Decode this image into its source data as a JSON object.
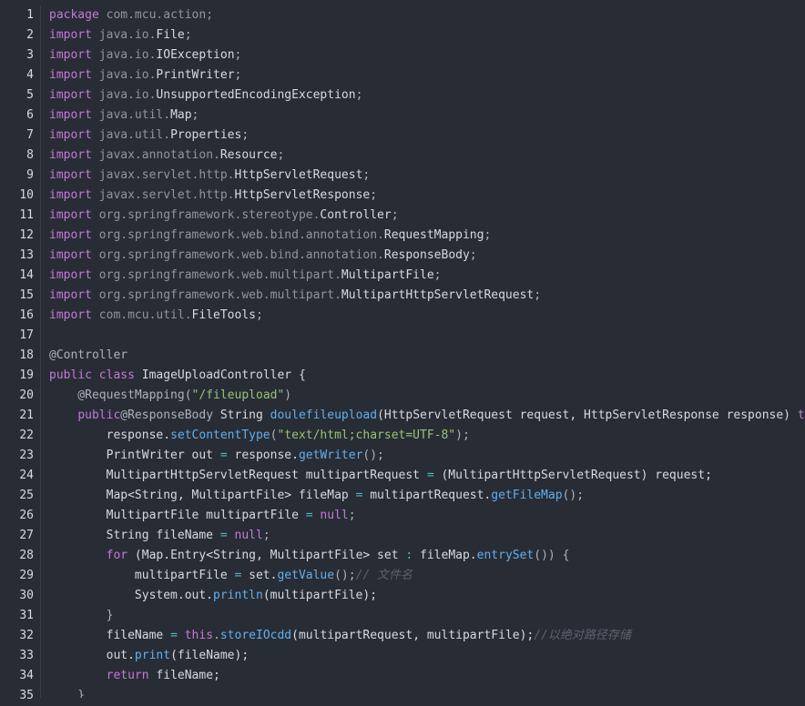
{
  "editor": {
    "line_numbers": [
      "1",
      "2",
      "3",
      "4",
      "5",
      "6",
      "7",
      "8",
      "9",
      "10",
      "11",
      "12",
      "13",
      "14",
      "15",
      "16",
      "17",
      "18",
      "19",
      "20",
      "21",
      "22",
      "23",
      "24",
      "25",
      "26",
      "27",
      "28",
      "29",
      "30",
      "31",
      "32",
      "33",
      "34",
      "35"
    ],
    "lines": [
      [
        {
          "t": "package",
          "c": "kw"
        },
        {
          "t": " com.mcu.action;",
          "c": "pkg"
        }
      ],
      [
        {
          "t": "import",
          "c": "kw"
        },
        {
          "t": " java.io.",
          "c": "pkg"
        },
        {
          "t": "File",
          "c": "ty"
        },
        {
          "t": ";",
          "c": "pl"
        }
      ],
      [
        {
          "t": "import",
          "c": "kw"
        },
        {
          "t": " java.io.",
          "c": "pkg"
        },
        {
          "t": "IOException",
          "c": "ty"
        },
        {
          "t": ";",
          "c": "pl"
        }
      ],
      [
        {
          "t": "import",
          "c": "kw"
        },
        {
          "t": " java.io.",
          "c": "pkg"
        },
        {
          "t": "PrintWriter",
          "c": "ty"
        },
        {
          "t": ";",
          "c": "pl"
        }
      ],
      [
        {
          "t": "import",
          "c": "kw"
        },
        {
          "t": " java.io.",
          "c": "pkg"
        },
        {
          "t": "UnsupportedEncodingException",
          "c": "ty"
        },
        {
          "t": ";",
          "c": "pl"
        }
      ],
      [
        {
          "t": "import",
          "c": "kw"
        },
        {
          "t": " java.util.",
          "c": "pkg"
        },
        {
          "t": "Map",
          "c": "ty"
        },
        {
          "t": ";",
          "c": "pl"
        }
      ],
      [
        {
          "t": "import",
          "c": "kw"
        },
        {
          "t": " java.util.",
          "c": "pkg"
        },
        {
          "t": "Properties",
          "c": "ty"
        },
        {
          "t": ";",
          "c": "pl"
        }
      ],
      [
        {
          "t": "import",
          "c": "kw"
        },
        {
          "t": " javax.annotation.",
          "c": "pkg"
        },
        {
          "t": "Resource",
          "c": "ty"
        },
        {
          "t": ";",
          "c": "pl"
        }
      ],
      [
        {
          "t": "import",
          "c": "kw"
        },
        {
          "t": " javax.servlet.http.",
          "c": "pkg"
        },
        {
          "t": "HttpServletRequest",
          "c": "ty"
        },
        {
          "t": ";",
          "c": "pl"
        }
      ],
      [
        {
          "t": "import",
          "c": "kw"
        },
        {
          "t": " javax.servlet.http.",
          "c": "pkg"
        },
        {
          "t": "HttpServletResponse",
          "c": "ty"
        },
        {
          "t": ";",
          "c": "pl"
        }
      ],
      [
        {
          "t": "import",
          "c": "kw"
        },
        {
          "t": " org.springframework.stereotype.",
          "c": "pkg"
        },
        {
          "t": "Controller",
          "c": "ty"
        },
        {
          "t": ";",
          "c": "pl"
        }
      ],
      [
        {
          "t": "import",
          "c": "kw"
        },
        {
          "t": " org.springframework.web.bind.annotation.",
          "c": "pkg"
        },
        {
          "t": "RequestMapping",
          "c": "ty"
        },
        {
          "t": ";",
          "c": "pl"
        }
      ],
      [
        {
          "t": "import",
          "c": "kw"
        },
        {
          "t": " org.springframework.web.bind.annotation.",
          "c": "pkg"
        },
        {
          "t": "ResponseBody",
          "c": "ty"
        },
        {
          "t": ";",
          "c": "pl"
        }
      ],
      [
        {
          "t": "import",
          "c": "kw"
        },
        {
          "t": " org.springframework.web.multipart.",
          "c": "pkg"
        },
        {
          "t": "MultipartFile",
          "c": "ty"
        },
        {
          "t": ";",
          "c": "pl"
        }
      ],
      [
        {
          "t": "import",
          "c": "kw"
        },
        {
          "t": " org.springframework.web.multipart.",
          "c": "pkg"
        },
        {
          "t": "MultipartHttpServletRequest",
          "c": "ty"
        },
        {
          "t": ";",
          "c": "pl"
        }
      ],
      [
        {
          "t": "import",
          "c": "kw"
        },
        {
          "t": " com.mcu.util.",
          "c": "pkg"
        },
        {
          "t": "FileTools",
          "c": "ty"
        },
        {
          "t": ";",
          "c": "pl"
        }
      ],
      [],
      [
        {
          "t": "@Controller",
          "c": "ann"
        }
      ],
      [
        {
          "t": "public",
          "c": "kw"
        },
        {
          "t": " ",
          "c": "pl"
        },
        {
          "t": "class",
          "c": "kw"
        },
        {
          "t": " ImageUploadController {",
          "c": "ty"
        }
      ],
      [
        {
          "t": "    @RequestMapping(",
          "c": "ann"
        },
        {
          "t": "\"/fileupload\"",
          "c": "str"
        },
        {
          "t": ")",
          "c": "ann"
        }
      ],
      [
        {
          "t": "    ",
          "c": "pl"
        },
        {
          "t": "public",
          "c": "kw"
        },
        {
          "t": "@ResponseBody",
          "c": "ann"
        },
        {
          "t": " String ",
          "c": "ty"
        },
        {
          "t": "doulefileupload",
          "c": "fn"
        },
        {
          "t": "(HttpServletRequest request, HttpServletResponse response) ",
          "c": "ty"
        },
        {
          "t": "throws",
          "c": "kw"
        }
      ],
      [
        {
          "t": "        response.",
          "c": "ty"
        },
        {
          "t": "setContentType",
          "c": "fn"
        },
        {
          "t": "(",
          "c": "pl"
        },
        {
          "t": "\"text/html;charset=UTF-8\"",
          "c": "str"
        },
        {
          "t": ");",
          "c": "pl"
        }
      ],
      [
        {
          "t": "        PrintWriter out ",
          "c": "ty"
        },
        {
          "t": "=",
          "c": "op"
        },
        {
          "t": " response.",
          "c": "ty"
        },
        {
          "t": "getWriter",
          "c": "fn"
        },
        {
          "t": "();",
          "c": "pl"
        }
      ],
      [
        {
          "t": "        MultipartHttpServletRequest multipartRequest ",
          "c": "ty"
        },
        {
          "t": "=",
          "c": "op"
        },
        {
          "t": " (MultipartHttpServletRequest) request;",
          "c": "ty"
        }
      ],
      [
        {
          "t": "        Map<String, MultipartFile> fileMap ",
          "c": "ty"
        },
        {
          "t": "=",
          "c": "op"
        },
        {
          "t": " multipartRequest.",
          "c": "ty"
        },
        {
          "t": "getFileMap",
          "c": "fn"
        },
        {
          "t": "();",
          "c": "pl"
        }
      ],
      [
        {
          "t": "        MultipartFile multipartFile ",
          "c": "ty"
        },
        {
          "t": "=",
          "c": "op"
        },
        {
          "t": " ",
          "c": "pl"
        },
        {
          "t": "null",
          "c": "kw"
        },
        {
          "t": ";",
          "c": "pl"
        }
      ],
      [
        {
          "t": "        String fileName ",
          "c": "ty"
        },
        {
          "t": "=",
          "c": "op"
        },
        {
          "t": " ",
          "c": "pl"
        },
        {
          "t": "null",
          "c": "kw"
        },
        {
          "t": ";",
          "c": "pl"
        }
      ],
      [
        {
          "t": "        ",
          "c": "pl"
        },
        {
          "t": "for",
          "c": "kw"
        },
        {
          "t": " (Map.Entry<String, MultipartFile> set ",
          "c": "ty"
        },
        {
          "t": ":",
          "c": "op"
        },
        {
          "t": " fileMap.",
          "c": "ty"
        },
        {
          "t": "entrySet",
          "c": "fn"
        },
        {
          "t": "()) {",
          "c": "pl"
        }
      ],
      [
        {
          "t": "            multipartFile ",
          "c": "ty"
        },
        {
          "t": "=",
          "c": "op"
        },
        {
          "t": " set.",
          "c": "ty"
        },
        {
          "t": "getValue",
          "c": "fn"
        },
        {
          "t": "();",
          "c": "pl"
        },
        {
          "t": "// 文件名",
          "c": "cm"
        }
      ],
      [
        {
          "t": "            System.out.",
          "c": "ty"
        },
        {
          "t": "println",
          "c": "fn"
        },
        {
          "t": "(multipartFile);",
          "c": "ty"
        }
      ],
      [
        {
          "t": "        }",
          "c": "pl"
        }
      ],
      [
        {
          "t": "        fileName ",
          "c": "ty"
        },
        {
          "t": "=",
          "c": "op"
        },
        {
          "t": " ",
          "c": "pl"
        },
        {
          "t": "this",
          "c": "kw"
        },
        {
          "t": ".",
          "c": "pl"
        },
        {
          "t": "storeIOcdd",
          "c": "fn"
        },
        {
          "t": "(multipartRequest, multipartFile);",
          "c": "ty"
        },
        {
          "t": "//以绝对路径存储",
          "c": "cm"
        }
      ],
      [
        {
          "t": "        out.",
          "c": "ty"
        },
        {
          "t": "print",
          "c": "fn"
        },
        {
          "t": "(fileName);",
          "c": "ty"
        }
      ],
      [
        {
          "t": "        ",
          "c": "pl"
        },
        {
          "t": "return",
          "c": "kw"
        },
        {
          "t": " fileName;",
          "c": "ty"
        }
      ],
      [
        {
          "t": "    }",
          "c": "pl"
        }
      ]
    ]
  },
  "colors": {
    "background": "#282c34",
    "keyword": "#c678dd",
    "function": "#61afef",
    "string": "#98c379",
    "comment": "#5c6370",
    "operator": "#56b6c2"
  }
}
